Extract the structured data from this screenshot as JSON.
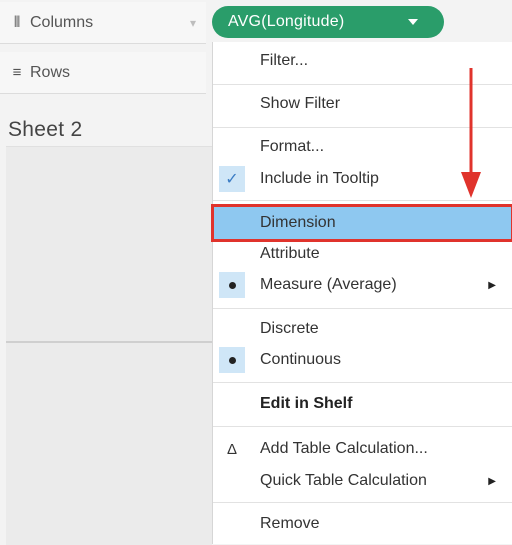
{
  "shelves": {
    "columns": {
      "icon": "columns-icon",
      "label": "Columns"
    },
    "rows": {
      "icon": "rows-icon",
      "label": "Rows"
    }
  },
  "sheet": {
    "title": "Sheet 2"
  },
  "pill": {
    "label": "AVG(Longitude)",
    "color": "#2a9d6a"
  },
  "menu": {
    "items": {
      "filter": "Filter...",
      "show_filter": "Show Filter",
      "format": "Format...",
      "include_tooltip": "Include in Tooltip",
      "dimension": "Dimension",
      "attribute": "Attribute",
      "measure": "Measure (Average)",
      "discrete": "Discrete",
      "continuous": "Continuous",
      "edit_in_shelf": "Edit in Shelf",
      "add_table_calc": "Add Table Calculation...",
      "quick_table_calc": "Quick Table Calculation",
      "remove": "Remove"
    },
    "highlight_color": "#8ec8f0",
    "annotation_color": "#e0332c"
  }
}
